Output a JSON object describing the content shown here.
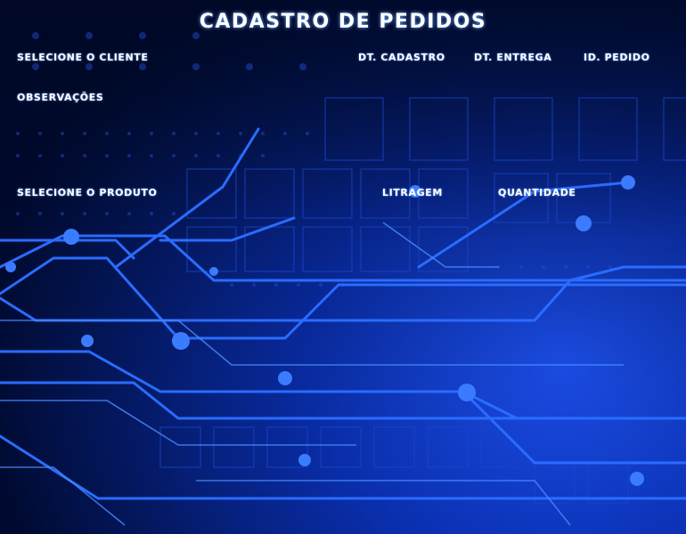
{
  "form": {
    "title": "Cadastro de Pedidos",
    "labels": {
      "cliente": "Selecione o Cliente",
      "dt_cadastro": "Dt. Cadastro",
      "dt_entrega": "Dt. Entrega",
      "id_pedido": "Id. Pedido",
      "observacoes": "Observações",
      "produto": "Selecione o Produto",
      "litragem": "Litragem",
      "quantidade": "Quantidade"
    }
  },
  "colors": {
    "background_dark": "#000c3a",
    "background_mid": "#0a2fb0",
    "trace": "#2a6cff",
    "label_text": "#ffffff"
  }
}
